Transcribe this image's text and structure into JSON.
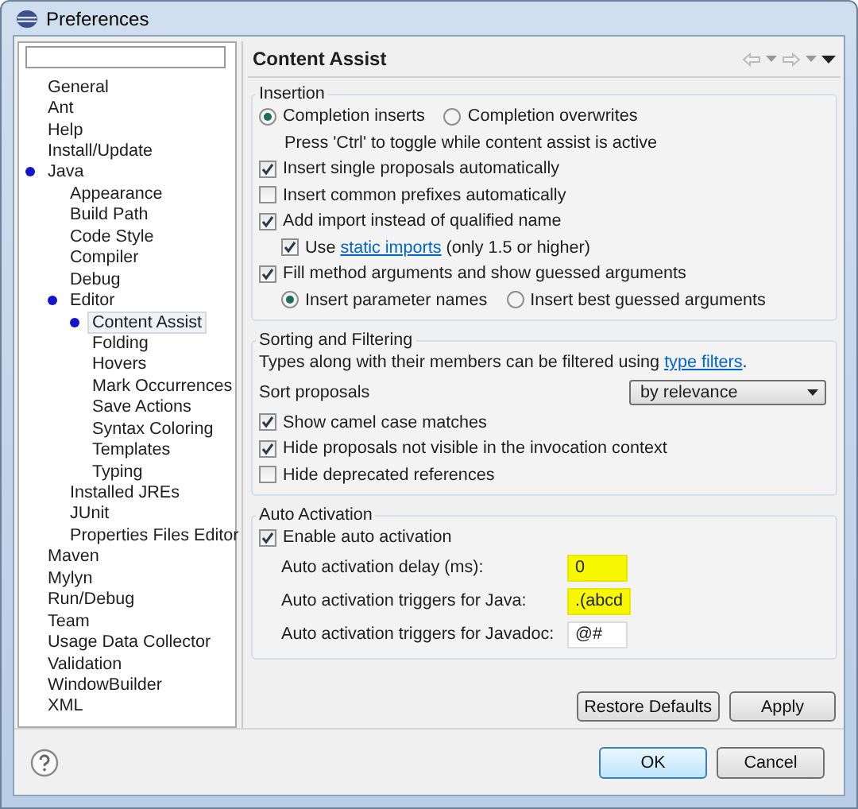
{
  "window": {
    "title": "Preferences"
  },
  "tree": [
    {
      "label": "General",
      "marked": false,
      "selected": false
    },
    {
      "label": "Ant",
      "marked": false,
      "selected": false
    },
    {
      "label": "Help",
      "marked": false,
      "selected": false
    },
    {
      "label": "Install/Update",
      "marked": false,
      "selected": false
    },
    {
      "label": "Java",
      "marked": true,
      "selected": false,
      "children": [
        {
          "label": "Appearance",
          "marked": false,
          "selected": false
        },
        {
          "label": "Build Path",
          "marked": false,
          "selected": false
        },
        {
          "label": "Code Style",
          "marked": false,
          "selected": false
        },
        {
          "label": "Compiler",
          "marked": false,
          "selected": false
        },
        {
          "label": "Debug",
          "marked": false,
          "selected": false
        },
        {
          "label": "Editor",
          "marked": true,
          "selected": false,
          "children": [
            {
              "label": "Content Assist",
              "marked": true,
              "selected": true
            },
            {
              "label": "Folding",
              "marked": false,
              "selected": false
            },
            {
              "label": "Hovers",
              "marked": false,
              "selected": false
            },
            {
              "label": "Mark Occurrences",
              "marked": false,
              "selected": false
            },
            {
              "label": "Save Actions",
              "marked": false,
              "selected": false
            },
            {
              "label": "Syntax Coloring",
              "marked": false,
              "selected": false
            },
            {
              "label": "Templates",
              "marked": false,
              "selected": false
            },
            {
              "label": "Typing",
              "marked": false,
              "selected": false
            }
          ]
        },
        {
          "label": "Installed JREs",
          "marked": false,
          "selected": false
        },
        {
          "label": "JUnit",
          "marked": false,
          "selected": false
        },
        {
          "label": "Properties Files Editor",
          "marked": false,
          "selected": false
        }
      ]
    },
    {
      "label": "Maven",
      "marked": false,
      "selected": false
    },
    {
      "label": "Mylyn",
      "marked": false,
      "selected": false
    },
    {
      "label": "Run/Debug",
      "marked": false,
      "selected": false
    },
    {
      "label": "Team",
      "marked": false,
      "selected": false
    },
    {
      "label": "Usage Data Collector",
      "marked": false,
      "selected": false
    },
    {
      "label": "Validation",
      "marked": false,
      "selected": false
    },
    {
      "label": "WindowBuilder",
      "marked": false,
      "selected": false
    },
    {
      "label": "XML",
      "marked": false,
      "selected": false
    }
  ],
  "page": {
    "title": "Content Assist"
  },
  "groups": [
    {
      "title": "Insertion",
      "rows": [
        {
          "kind": "radios",
          "options": [
            {
              "label": "Completion inserts",
              "selected": true
            },
            {
              "label": "Completion overwrites",
              "selected": false
            }
          ]
        },
        {
          "kind": "note",
          "text": "Press 'Ctrl' to toggle while content assist is active"
        },
        {
          "kind": "checkbox",
          "label": "Insert single proposals automatically",
          "checked": true
        },
        {
          "kind": "checkbox",
          "label": "Insert common prefixes automatically",
          "checked": false
        },
        {
          "kind": "checkbox",
          "label": "Add import instead of qualified name",
          "checked": true,
          "children": [
            {
              "kind": "checkbox",
              "label": "Use",
              "link": "static imports",
              "suffix": "(only 1.5 or higher)",
              "checked": true
            }
          ]
        },
        {
          "kind": "checkbox",
          "label": "Fill method arguments and show guessed arguments",
          "checked": true,
          "children": [
            {
              "kind": "radios",
              "options": [
                {
                  "label": "Insert parameter names",
                  "selected": true
                },
                {
                  "label": "Insert best guessed arguments",
                  "selected": false
                }
              ]
            }
          ]
        }
      ]
    },
    {
      "title": "Sorting and Filtering",
      "rows": [
        {
          "kind": "text",
          "text": "Types along with their members can be filtered using",
          "link": "type filters",
          "suffix": "."
        },
        {
          "kind": "select",
          "label": "Sort proposals",
          "value": "by relevance"
        },
        {
          "kind": "checkbox",
          "label": "Show camel case matches",
          "checked": true
        },
        {
          "kind": "checkbox",
          "label": "Hide proposals not visible in the invocation context",
          "checked": true
        },
        {
          "kind": "checkbox",
          "label": "Hide deprecated references",
          "checked": false
        }
      ]
    },
    {
      "title": "Auto Activation",
      "rows": [
        {
          "kind": "checkbox",
          "label": "Enable auto activation",
          "checked": true,
          "children": [
            {
              "kind": "field",
              "label": "Auto activation delay (ms):",
              "value": "0",
              "highlighted": true
            },
            {
              "kind": "field",
              "label": "Auto activation triggers for Java:",
              "value": ".(abcd",
              "highlighted": true
            },
            {
              "kind": "field",
              "label": "Auto activation triggers for Javadoc:",
              "value": "@#",
              "highlighted": false
            }
          ]
        }
      ]
    }
  ],
  "page_buttons": [
    "Restore Defaults",
    "Apply"
  ],
  "dialog_buttons": [
    {
      "label": "OK",
      "default": true
    },
    {
      "label": "Cancel",
      "default": false
    }
  ]
}
